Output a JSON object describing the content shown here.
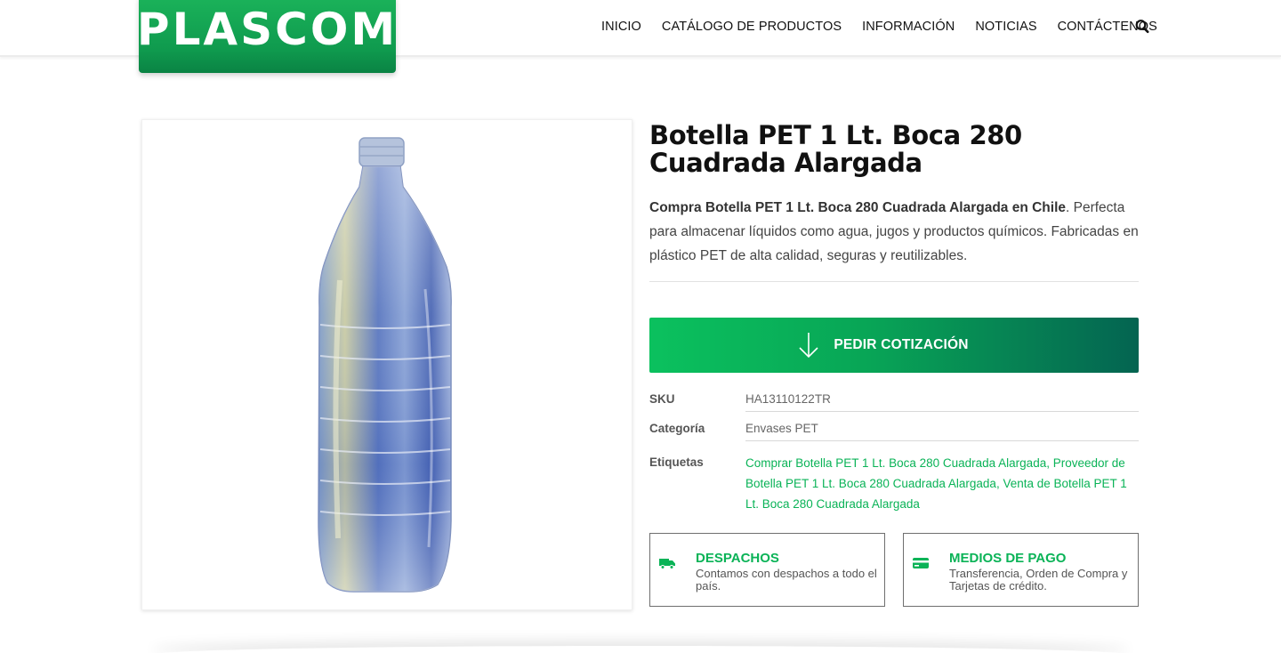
{
  "header": {
    "logo": "PLASCOM",
    "nav": [
      "INICIO",
      "CATÁLOGO DE PRODUCTOS",
      "INFORMACIÓN",
      "NOTICIAS",
      "CONTÁCTENOS"
    ],
    "search_icon": "search-icon"
  },
  "product": {
    "title": "Botella PET 1 Lt. Boca 280 Cuadrada Alargada",
    "desc_bold": "Compra Botella PET 1 Lt. Boca 280 Cuadrada Alargada en Chile",
    "desc_rest": ". Perfecta para almacenar líquidos como agua, jugos y productos químicos. Fabricadas en plástico PET de alta calidad, seguras y reutilizables.",
    "quote_button": "PEDIR COTIZACIÓN",
    "sku_label": "SKU",
    "sku": "HA13110122TR",
    "category_label": "Categoría",
    "category": "Envases PET",
    "tags_label": "Etiquetas",
    "tags": [
      "Comprar Botella PET 1 Lt. Boca 280 Cuadrada Alargada",
      "Proveedor de Botella PET 1 Lt. Boca 280 Cuadrada Alargada",
      "Venta de Botella PET 1 Lt. Boca 280 Cuadrada Alargada"
    ]
  },
  "info_boxes": [
    {
      "icon": "truck-icon",
      "title": "DESPACHOS",
      "text": "Contamos con despachos a todo el país."
    },
    {
      "icon": "credit-card-icon",
      "title": "MEDIOS DE PAGO",
      "text": "Transferencia, Orden de Compra y Tarjetas de crédito."
    }
  ],
  "colors": {
    "brand_green": "#0ab357",
    "gradient_end": "#046451"
  }
}
